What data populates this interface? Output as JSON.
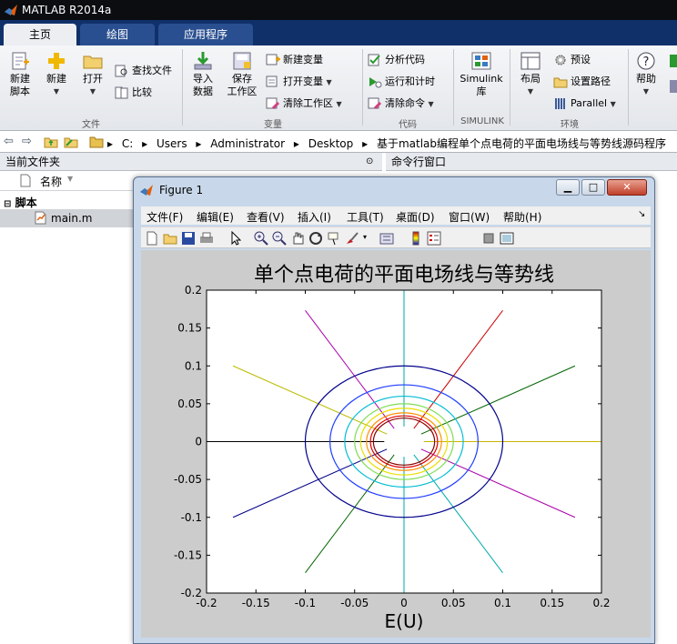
{
  "app": {
    "title": "MATLAB R2014a"
  },
  "tabs": [
    {
      "label": "主页"
    },
    {
      "label": "绘图"
    },
    {
      "label": "应用程序"
    }
  ],
  "ribbon": {
    "new_script": "新建\n脚本",
    "new": "新建",
    "open": "打开",
    "find_files": "查找文件",
    "compare": "比较",
    "group_file": "文件",
    "import": "导入\n数据",
    "save_ws": "保存\n工作区",
    "new_var": "新建变量",
    "open_var": "打开变量",
    "clear_ws": "清除工作区",
    "group_var": "变量",
    "analyze": "分析代码",
    "run_time": "运行和计时",
    "clear_cmd": "清除命令",
    "group_code": "代码",
    "simulink": "Simulink\n库",
    "group_simulink": "SIMULINK",
    "layout": "布局",
    "prefs": "预设",
    "set_path": "设置路径",
    "parallel": "Parallel",
    "group_env": "环境",
    "help": "帮助"
  },
  "address": {
    "crumbs": [
      "C:",
      "Users",
      "Administrator",
      "Desktop",
      "基于matlab编程单个点电荷的平面电场线与等势线源码程序"
    ]
  },
  "panels": {
    "current_folder": "当前文件夹",
    "command_window": "命令行窗口",
    "name_col": "名称",
    "group_script": "脚本",
    "file": "main.m"
  },
  "figure": {
    "window_title": "Figure 1",
    "menus": [
      "文件(F)",
      "编辑(E)",
      "查看(V)",
      "插入(I)",
      "工具(T)",
      "桌面(D)",
      "窗口(W)",
      "帮助(H)"
    ]
  },
  "chart_data": {
    "type": "line",
    "title": "单个点电荷的平面电场线与等势线",
    "xlabel": "E(U)",
    "ylabel": "",
    "xlim": [
      -0.2,
      0.2
    ],
    "ylim": [
      -0.2,
      0.2
    ],
    "xticks": [
      "-0.2",
      "-0.15",
      "-0.1",
      "-0.05",
      "0",
      "0.05",
      "0.1",
      "0.15",
      "0.2"
    ],
    "yticks": [
      "-0.2",
      "-0.15",
      "-0.1",
      "-0.05",
      "0",
      "0.05",
      "0.1",
      "0.15",
      "0.2"
    ],
    "field_lines": {
      "angles_deg": [
        0,
        30,
        60,
        90,
        120,
        150,
        180,
        210,
        240,
        270,
        300,
        330
      ],
      "inner_radius": 0.02,
      "outer_radius": 0.2,
      "colors": [
        "#c8b400",
        "#006400",
        "#cc0000",
        "#00aaaa",
        "#aa00aa",
        "#bbbb00",
        "#000000",
        "#000088",
        "#006600",
        "#00aaaa",
        "#00aaaa",
        "#aa00aa"
      ]
    },
    "equipotentials": [
      {
        "radius": 0.1,
        "color": "#00008b"
      },
      {
        "radius": 0.075,
        "color": "#1e3cff"
      },
      {
        "radius": 0.06,
        "color": "#00bcd4"
      },
      {
        "radius": 0.05,
        "color": "#7fdd55"
      },
      {
        "radius": 0.044,
        "color": "#e8e000"
      },
      {
        "radius": 0.038,
        "color": "#ff9000"
      },
      {
        "radius": 0.034,
        "color": "#e00000"
      },
      {
        "radius": 0.031,
        "color": "#8b0000"
      }
    ]
  }
}
